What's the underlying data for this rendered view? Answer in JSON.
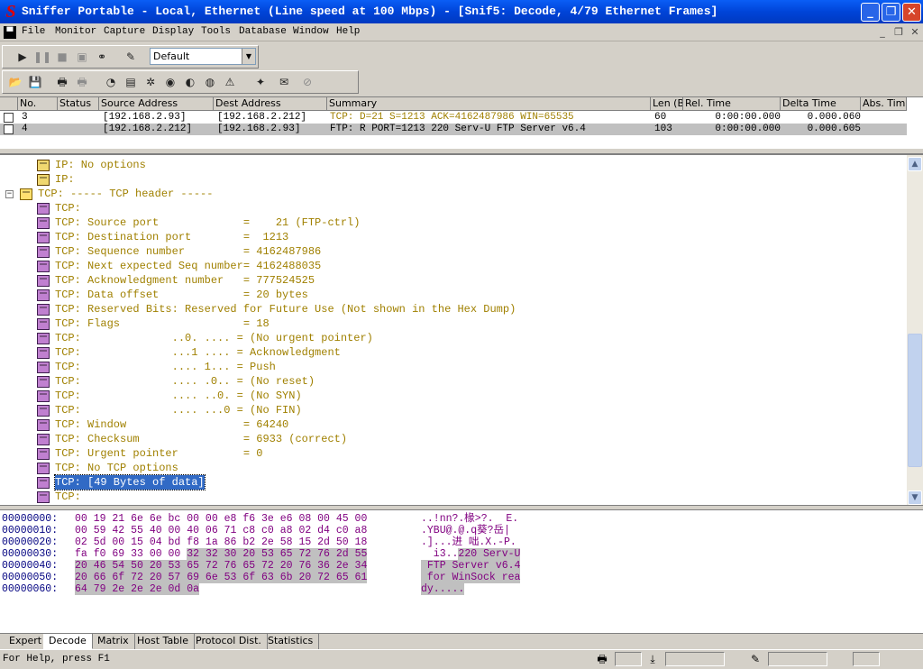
{
  "window": {
    "title": "Sniffer Portable - Local, Ethernet (Line speed at 100 Mbps) - [Snif5: Decode, 4/79 Ethernet Frames]",
    "app_icon_letter": "S",
    "minimize_glyph": "_",
    "restore_glyph": "❐",
    "close_glyph": "✕"
  },
  "menu": [
    "File",
    "Monitor",
    "Capture",
    "Display",
    "Tools",
    "Database",
    "Window",
    "Help"
  ],
  "toolbar": {
    "profile_value": "Default"
  },
  "packet_list": {
    "columns": [
      "No.",
      "Status",
      "Source Address",
      "Dest Address",
      "Summary",
      "Len (B",
      "Rel. Time",
      "Delta Time",
      "Abs. Time"
    ],
    "rows": [
      {
        "no": "3",
        "status": "",
        "src": "[192.168.2.93]",
        "dst": "[192.168.2.212]",
        "summary": "TCP: D=21 S=1213     ACK=4162487986 WIN=65535",
        "len": "60",
        "rel": "0:00:00.000",
        "delta": "0.000.060",
        "abs": ""
      },
      {
        "no": "4",
        "status": "",
        "src": "[192.168.2.212]",
        "dst": "[192.168.2.93]",
        "summary": "FTP: R PORT=1213    220 Serv-U FTP Server v6.4",
        "len": "103",
        "rel": "0:00:00.000",
        "delta": "0.000.605",
        "abs": ""
      }
    ]
  },
  "decode": {
    "lines": [
      {
        "text": "IP: No options",
        "kind": "ip"
      },
      {
        "text": "IP:",
        "kind": "ip"
      },
      {
        "text": "TCP: ----- TCP header -----",
        "kind": "hdr"
      },
      {
        "text": "TCP:",
        "kind": "tcp"
      },
      {
        "text": "TCP: Source port             =    21 (FTP-ctrl)",
        "kind": "tcp"
      },
      {
        "text": "TCP: Destination port        =  1213",
        "kind": "tcp"
      },
      {
        "text": "TCP: Sequence number         = 4162487986",
        "kind": "tcp"
      },
      {
        "text": "TCP: Next expected Seq number= 4162488035",
        "kind": "tcp"
      },
      {
        "text": "TCP: Acknowledgment number   = 777524525",
        "kind": "tcp"
      },
      {
        "text": "TCP: Data offset             = 20 bytes",
        "kind": "tcp"
      },
      {
        "text": "TCP: Reserved Bits: Reserved for Future Use (Not shown in the Hex Dump)",
        "kind": "tcp"
      },
      {
        "text": "TCP: Flags                   = 18",
        "kind": "tcp"
      },
      {
        "text": "TCP:              ..0. .... = (No urgent pointer)",
        "kind": "tcp"
      },
      {
        "text": "TCP:              ...1 .... = Acknowledgment",
        "kind": "tcp"
      },
      {
        "text": "TCP:              .... 1... = Push",
        "kind": "tcp"
      },
      {
        "text": "TCP:              .... .0.. = (No reset)",
        "kind": "tcp"
      },
      {
        "text": "TCP:              .... ..0. = (No SYN)",
        "kind": "tcp"
      },
      {
        "text": "TCP:              .... ...0 = (No FIN)",
        "kind": "tcp"
      },
      {
        "text": "TCP: Window                  = 64240",
        "kind": "tcp"
      },
      {
        "text": "TCP: Checksum                = 6933 (correct)",
        "kind": "tcp"
      },
      {
        "text": "TCP: Urgent pointer          = 0",
        "kind": "tcp"
      },
      {
        "text": "TCP: No TCP options",
        "kind": "tcp"
      },
      {
        "text": "TCP: [49 Bytes of data]",
        "kind": "tcp",
        "selected": true
      },
      {
        "text": "TCP:",
        "kind": "tcp"
      }
    ]
  },
  "hex": {
    "lines": [
      {
        "offset": "00000000:",
        "bytes_a": "00 19 21 6e 6e bc 00 00 e8 f6 3e e6 08 00 45 00",
        "bytes_hl": "",
        "ascii_a": "..!nn?.椽>?.  E.",
        "ascii_hl": ""
      },
      {
        "offset": "00000010:",
        "bytes_a": "00 59 42 55 40 00 40 06 71 c8 c0 a8 02 d4 c0 a8",
        "bytes_hl": "",
        "ascii_a": ".YBU@.@.q葵?岳|",
        "ascii_hl": ""
      },
      {
        "offset": "00000020:",
        "bytes_a": "02 5d 00 15 04 bd f8 1a 86 b2 2e 58 15 2d 50 18",
        "bytes_hl": "",
        "ascii_a": ".]...进 咄.X.-P.",
        "ascii_hl": ""
      },
      {
        "offset": "00000030:",
        "bytes_a": "fa f0 69 33 00 00 ",
        "bytes_hl": "32 32 30 20 53 65 72 76 2d 55",
        "ascii_a": "  i3..",
        "ascii_hl": "220 Serv-U"
      },
      {
        "offset": "00000040:",
        "bytes_a": "",
        "bytes_hl": "20 46 54 50 20 53 65 72 76 65 72 20 76 36 2e 34",
        "ascii_a": "",
        "ascii_hl": " FTP Server v6.4"
      },
      {
        "offset": "00000050:",
        "bytes_a": "",
        "bytes_hl": "20 66 6f 72 20 57 69 6e 53 6f 63 6b 20 72 65 61",
        "ascii_a": "",
        "ascii_hl": " for WinSock rea"
      },
      {
        "offset": "00000060:",
        "bytes_a": "",
        "bytes_hl": "64 79 2e 2e 2e 0d 0a",
        "ascii_a": "",
        "ascii_hl": "dy....."
      }
    ]
  },
  "tabs": [
    "Expert",
    "Decode",
    "Matrix",
    "Host Table",
    "Protocol Dist.",
    "Statistics"
  ],
  "active_tab": "Decode",
  "status": {
    "text": "For Help, press F1"
  }
}
